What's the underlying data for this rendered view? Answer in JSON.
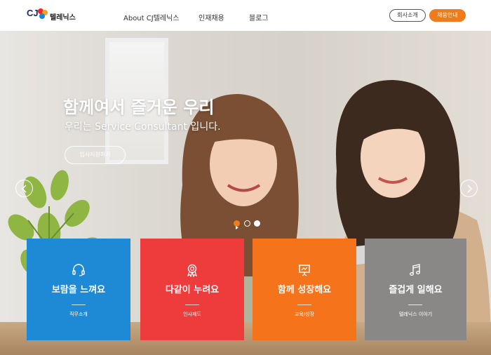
{
  "header": {
    "logo_mark": "CJ",
    "logo_text": "텔레닉스",
    "nav": [
      "About CJ텔레닉스",
      "인재채용",
      "블로그"
    ],
    "company_button": "회사소개",
    "recruit_button": "채용안내"
  },
  "hero": {
    "title": "함께여서 즐거운 우리",
    "subtitle": "우리는 Service Consultant 입니다.",
    "apply_button": "입사지원하기",
    "slides_total": 2,
    "current_slide": 2
  },
  "cards": [
    {
      "title": "보람을 느껴요",
      "subtitle": "직무소개",
      "icon": "headset-icon",
      "color": "#1e8ad6"
    },
    {
      "title": "다같이 누려요",
      "subtitle": "인사제도",
      "icon": "award-icon",
      "color": "#ee3b3b"
    },
    {
      "title": "함께 성장해요",
      "subtitle": "교육/성장",
      "icon": "presentation-icon",
      "color": "#f5731b"
    },
    {
      "title": "즐겁게 일해요",
      "subtitle": "텔레닉스 이야기",
      "icon": "music-note-icon",
      "color": "#8a8886"
    }
  ],
  "colors": {
    "accent": "#ef7b1a",
    "header_bg": "#ffffff"
  }
}
